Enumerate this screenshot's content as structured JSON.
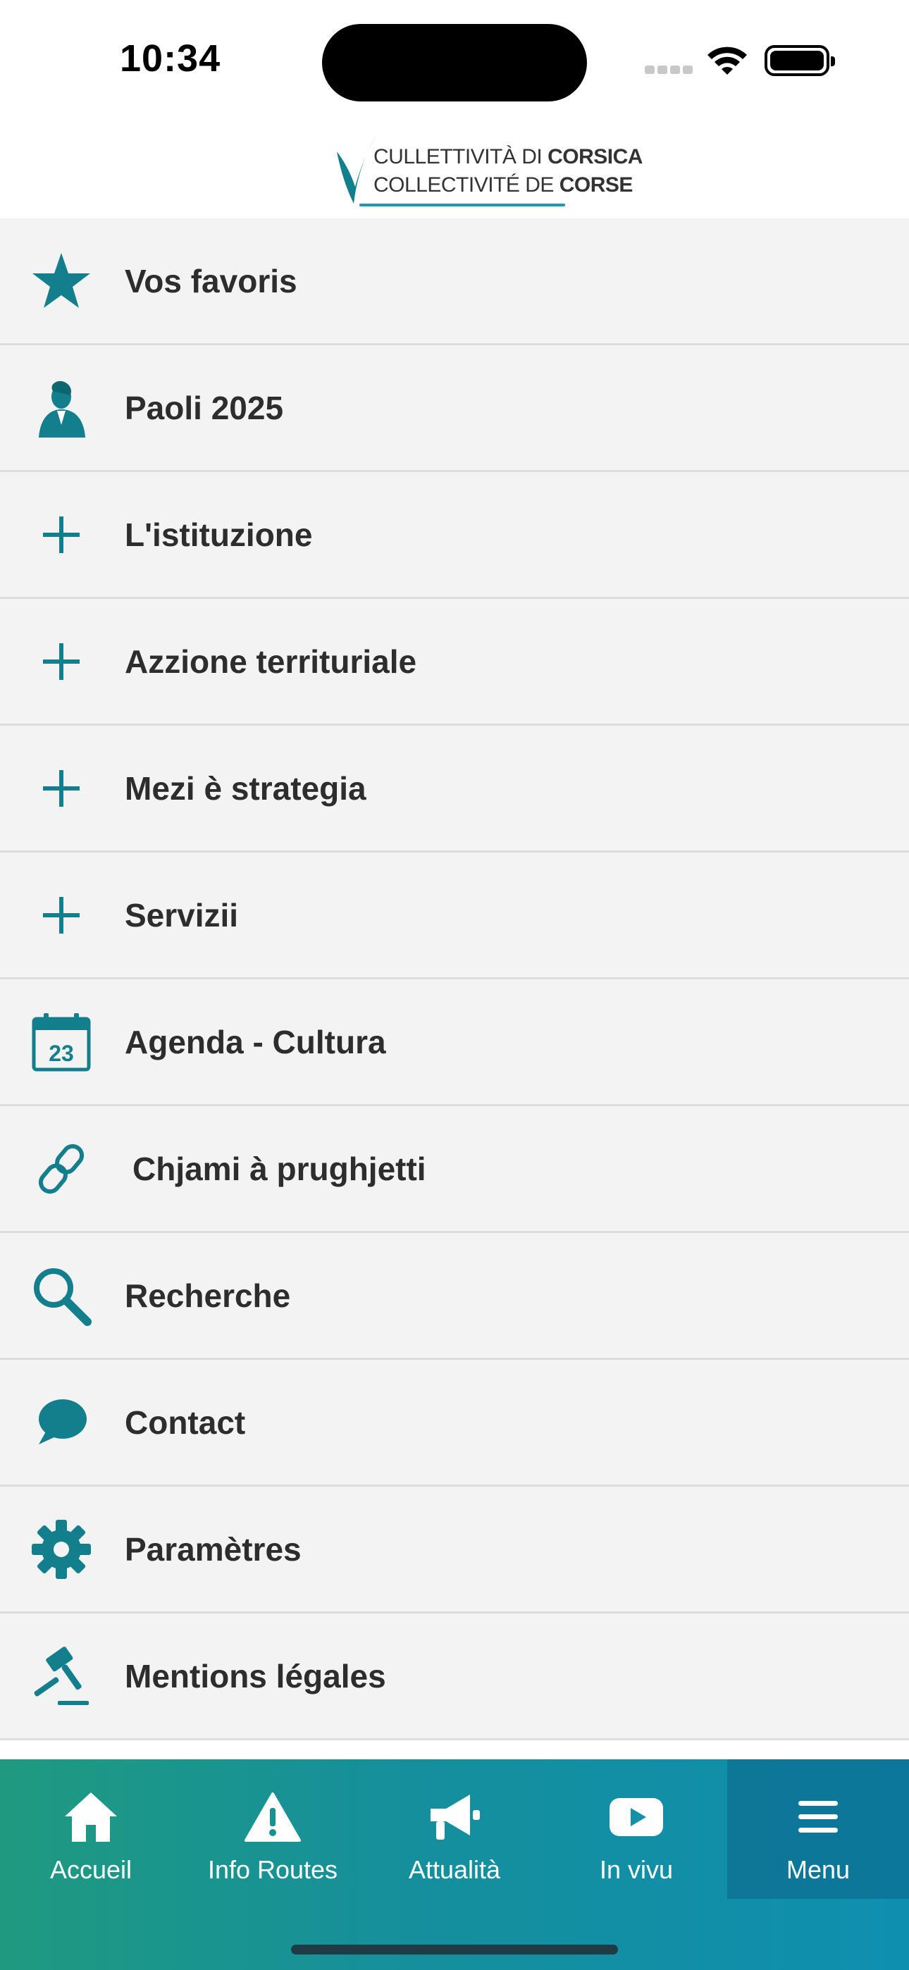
{
  "status_bar": {
    "time": "10:34"
  },
  "header": {
    "logo_line1_light": "CULLETTIVITÀ DI",
    "logo_line1_bold": "CORSICA",
    "logo_line2_light": "COLLECTIVITÉ DE",
    "logo_line2_bold": "CORSE"
  },
  "colors": {
    "accent": "#137f8c",
    "menu_background": "#f3f3f3",
    "divider": "#dcdcdc",
    "tabbar_gradient_start": "#1f9a80",
    "tabbar_gradient_end": "#0f8fb0"
  },
  "menu": {
    "items": [
      {
        "label": "Vos favoris",
        "icon": "star-icon"
      },
      {
        "label": "Paoli 2025",
        "icon": "portrait-icon"
      },
      {
        "label": "L'istituzione",
        "icon": "plus-icon"
      },
      {
        "label": "Azzione territuriale",
        "icon": "plus-icon"
      },
      {
        "label": "Mezi è strategia",
        "icon": "plus-icon"
      },
      {
        "label": "Servizii",
        "icon": "plus-icon"
      },
      {
        "label": "Agenda - Cultura",
        "icon": "calendar-icon",
        "calendar_day": "23"
      },
      {
        "label": "Chjami à prughjetti",
        "icon": "link-icon"
      },
      {
        "label": "Recherche",
        "icon": "search-icon"
      },
      {
        "label": "Contact",
        "icon": "speech-bubble-icon"
      },
      {
        "label": "Paramètres",
        "icon": "gear-icon"
      },
      {
        "label": "Mentions légales",
        "icon": "gavel-icon"
      }
    ]
  },
  "tabbar": {
    "tabs": [
      {
        "label": "Accueil",
        "icon": "home-icon"
      },
      {
        "label": "Info Routes",
        "icon": "warning-icon"
      },
      {
        "label": "Attualità",
        "icon": "megaphone-icon"
      },
      {
        "label": "In vivu",
        "icon": "play-icon"
      },
      {
        "label": "Menu",
        "icon": "hamburger-icon",
        "active": true
      }
    ]
  }
}
